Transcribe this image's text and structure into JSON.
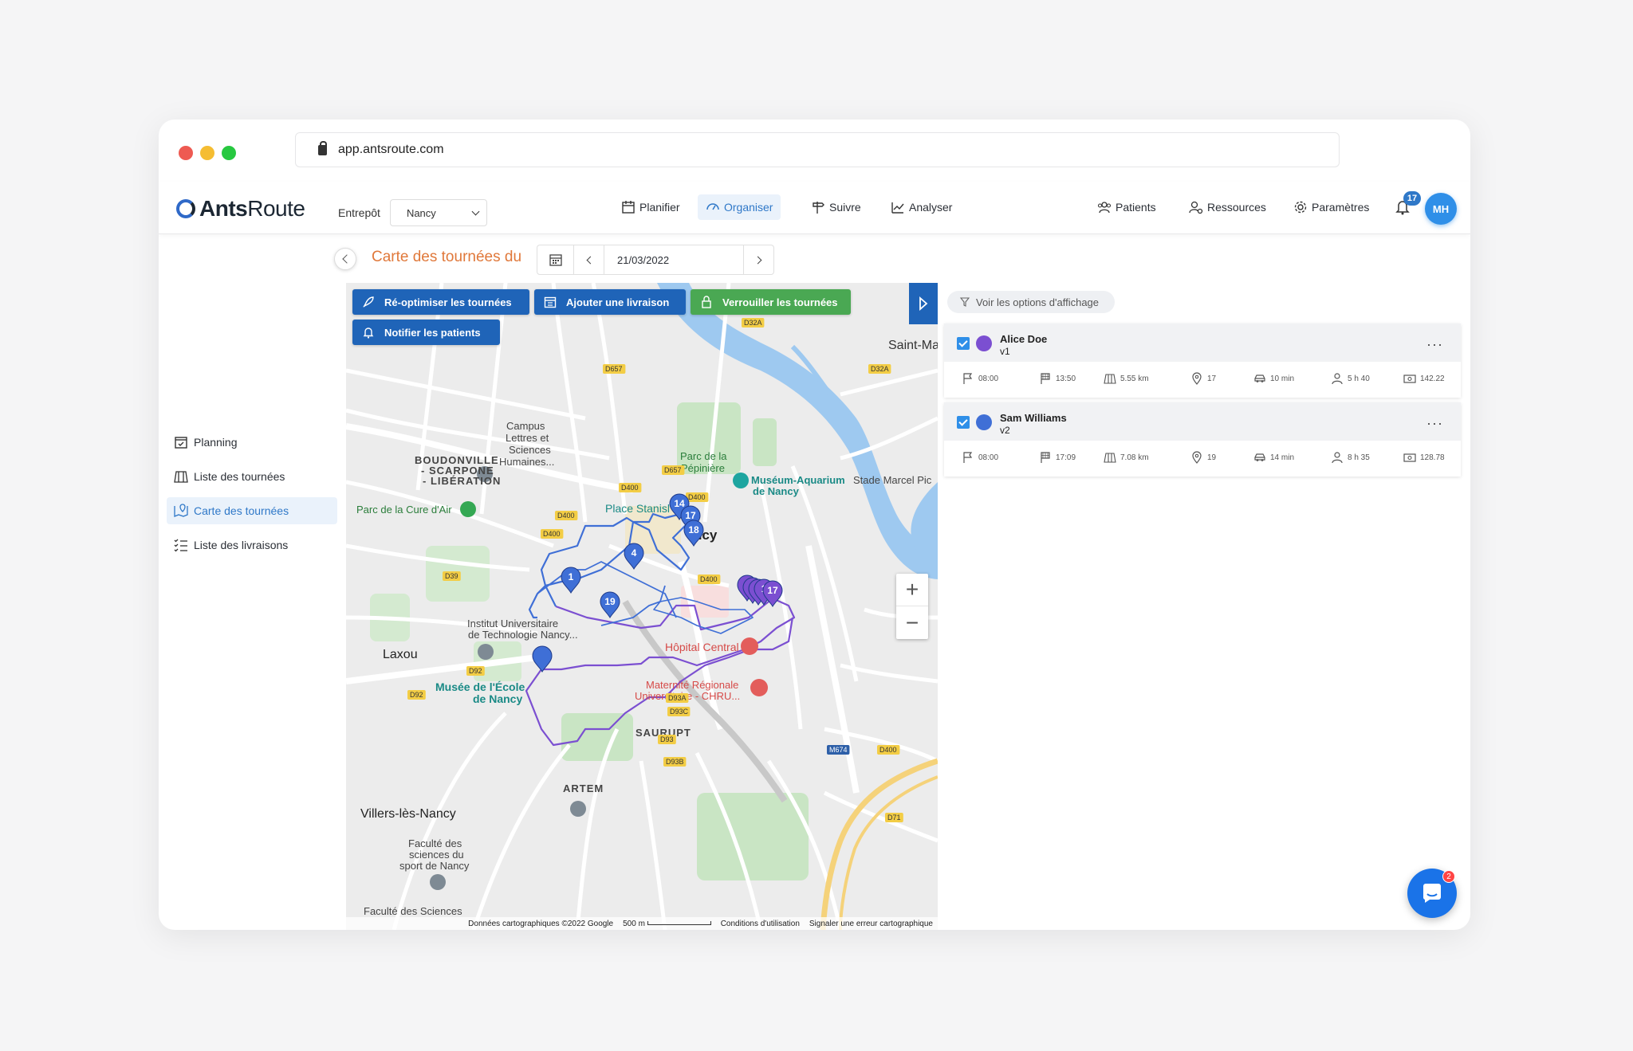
{
  "browser": {
    "url": "app.antsroute.com",
    "dots": [
      "#ee5a52",
      "#f5bd32",
      "#27c840"
    ]
  },
  "app": {
    "logo_bold": "Ants",
    "logo_light": "Route",
    "warehouse_label": "Entrepôt",
    "warehouse_value": "Nancy",
    "nav": [
      {
        "label": "Planifier",
        "icon": "calendar-icon"
      },
      {
        "label": "Organiser",
        "icon": "gauge-icon",
        "active": true
      },
      {
        "label": "Suivre",
        "icon": "signpost-icon"
      },
      {
        "label": "Analyser",
        "icon": "chart-icon"
      }
    ],
    "nav_right": [
      {
        "label": "Patients",
        "icon": "users-icon"
      },
      {
        "label": "Ressources",
        "icon": "user-gear-icon"
      },
      {
        "label": "Paramètres",
        "icon": "gear-icon"
      }
    ],
    "notifications": "17",
    "avatar": "MH",
    "accent": "#2f78c8"
  },
  "sidebar": {
    "items": [
      {
        "label": "Planning",
        "icon": "calendar-check-icon"
      },
      {
        "label": "Liste des tournées",
        "icon": "map-fold-icon"
      },
      {
        "label": "Carte des tournées",
        "icon": "map-pin-icon",
        "active": true
      },
      {
        "label": "Liste des livraisons",
        "icon": "list-icon"
      }
    ]
  },
  "header": {
    "title": "Carte des tournées du",
    "date": "21/03/2022"
  },
  "map": {
    "buttons": {
      "reoptimize": "Ré-optimiser les tournées",
      "add_delivery": "Ajouter une livraison",
      "lock": "Verrouiller les tournées",
      "notify": "Notifier les patients"
    },
    "labels": {
      "saint_ma": "Saint-Ma",
      "campus": "Campus",
      "lettres": "Lettres et",
      "sciences": "Sciences",
      "humaines": "Humaines...",
      "parc_pep1": "Parc de la",
      "parc_pep2": "Pépinière",
      "museum1": "Muséum-Aquarium",
      "museum2": "de Nancy",
      "stade": "Stade Marcel Pic",
      "boudon1": "BOUDONVILLE",
      "boudon2": "- SCARPONE",
      "boudon3": "- LIBÉRATION",
      "parc_cure": "Parc de la Cure d'Air",
      "place": "Place Stanisl",
      "nancy": "ncy",
      "iut1": "Institut Universitaire",
      "iut2": "de Technologie Nancy...",
      "laxou": "Laxou",
      "hopital": "Hôpital Central",
      "maternite1": "Maternité Régionale",
      "maternite2": "Universitaire - CHRU...",
      "musee1": "Musée de l'École",
      "musee2": "de Nancy",
      "saurupt": "SAURUPT",
      "artem": "ARTEM",
      "villers": "Villers-lès-Nancy",
      "faculte1": "Faculté des",
      "faculte2": "sciences du",
      "faculte3": "sport de Nancy",
      "faculte_bottom": "Faculté des Sciences"
    },
    "roads": [
      "D32A",
      "D657",
      "D400",
      "D400",
      "D32A",
      "D657",
      "D400",
      "D400",
      "D400",
      "D39",
      "D92",
      "D92",
      "D93A",
      "D93C",
      "D93",
      "D93B",
      "M674",
      "D400",
      "D71",
      "M674"
    ],
    "markers_blue": [
      "14",
      "17",
      "18",
      "4",
      "1",
      "19"
    ],
    "markers_purple": [
      "1",
      "17"
    ],
    "zoom_in": "+",
    "zoom_out": "−",
    "footer": {
      "data": "Données cartographiques ©2022 Google",
      "scale": "500 m",
      "terms": "Conditions d'utilisation",
      "report": "Signaler une erreur cartographique"
    },
    "route_colors": {
      "v1": "#7b4fd1",
      "v2": "#3f6fd6"
    }
  },
  "panel": {
    "options_label": "Voir les options d'affichage",
    "vehicles": [
      {
        "name": "Alice Doe",
        "id": "v1",
        "color": "#7b4fd1",
        "start": "08:00",
        "end": "13:50",
        "distance": "5.55 km",
        "stops": "17",
        "drive": "10 min",
        "work": "5 h 40",
        "cost": "142.22",
        "more": "···"
      },
      {
        "name": "Sam Williams",
        "id": "v2",
        "color": "#3f6fd6",
        "start": "08:00",
        "end": "17:09",
        "distance": "7.08 km",
        "stops": "19",
        "drive": "14 min",
        "work": "8 h 35",
        "cost": "128.78",
        "more": "···"
      }
    ]
  },
  "chat": {
    "badge": "2"
  }
}
